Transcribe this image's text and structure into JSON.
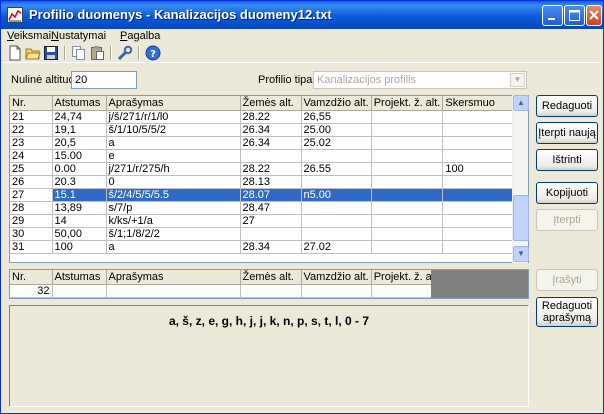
{
  "window": {
    "title": "Profilio duomenys - Kanalizacijos duomeny12.txt",
    "controls": [
      "minimize",
      "maximize",
      "close"
    ]
  },
  "menu": [
    "Veiksmai",
    "Nustatymai",
    "Pagalba"
  ],
  "toolbar_icons": [
    "new-file-icon",
    "open-folder-icon",
    "save-icon",
    "copy-icon",
    "paste-icon",
    "tools-icon",
    "help-icon"
  ],
  "fields": {
    "altitude_label": "Nulinė altitudė",
    "altitude_value": "20",
    "profile_type_label": "Profilio tipas",
    "profile_type_value": "Kanalizacijos profilis"
  },
  "grid": {
    "columns": [
      "Nr.",
      "Atstumas",
      "Aprašymas",
      "Žemės alt.",
      "Vamzdžio alt.",
      "Projekt. ž. alt.",
      "Skersmuo"
    ],
    "rows": [
      [
        "21",
        "24,74",
        "j/š/271/r/1/l0",
        "28.22",
        "26,55",
        "",
        ""
      ],
      [
        "22",
        "19,1",
        "š/1/10/5/5/2",
        "26.34",
        "25.00",
        "",
        ""
      ],
      [
        "23",
        "20,5",
        "a",
        "26.34",
        "25.02",
        "",
        ""
      ],
      [
        "24",
        "15.00",
        "e",
        "",
        "",
        "",
        ""
      ],
      [
        "25",
        "0.00",
        "j/271/r/275/h",
        "28.22",
        "26.55",
        "",
        "100"
      ],
      [
        "26",
        "20.3",
        "0",
        "28.13",
        "",
        "",
        ""
      ],
      [
        "27",
        "15.1",
        "š/2/4/5/5/5.5",
        "28.07",
        "n5.00",
        "",
        ""
      ],
      [
        "28",
        "13,89",
        "s/7/p",
        "28.47",
        "",
        "",
        ""
      ],
      [
        "29",
        "14",
        "k/ks/+1/a",
        "27",
        "",
        "",
        ""
      ],
      [
        "30",
        "50,00",
        "š/1;1/8/2/2",
        "",
        "",
        "",
        ""
      ],
      [
        "31",
        "100",
        "a",
        "28.34",
        "27.02",
        "",
        ""
      ]
    ],
    "selected_row": 6
  },
  "new_row": {
    "columns": [
      "Nr.",
      "Atstumas",
      "Aprašymas",
      "Žemės alt.",
      "Vamzdžio alt.",
      "Projekt. ž. alt."
    ],
    "values": [
      "32",
      "",
      "",
      "",
      "",
      ""
    ]
  },
  "buttons": {
    "edit": "Redaguoti",
    "insert_new": "Įterpti naują",
    "delete": "Ištrinti",
    "copy": "Kopijuoti",
    "insert": "Įterpti",
    "write": "Įrašyti",
    "edit_desc_line1": "Redaguoti",
    "edit_desc_line2": "aprašymą"
  },
  "legend_text": "a, š, z, e, g, h, j, j, k, n, p, s, t, l, 0 - 7"
}
